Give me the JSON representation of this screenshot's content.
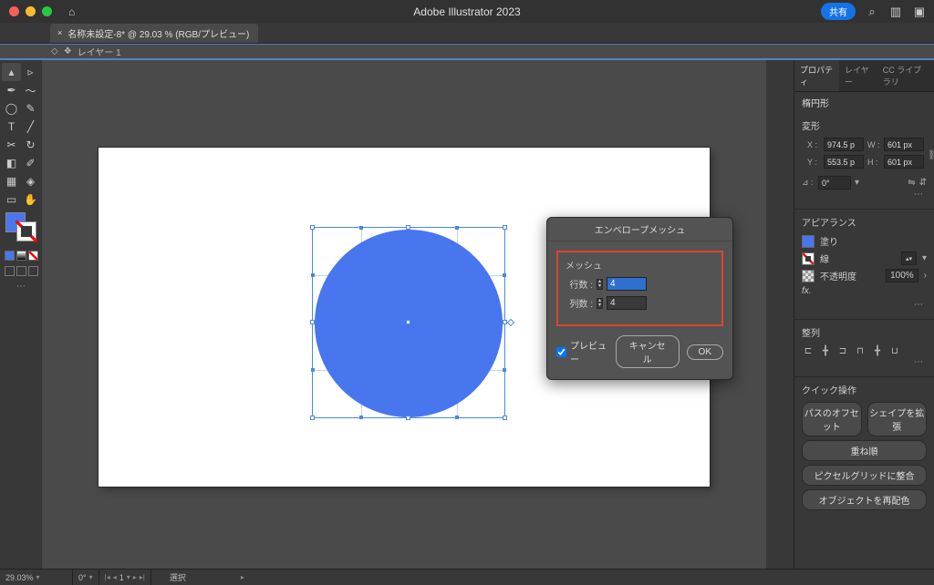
{
  "app": {
    "title": "Adobe Illustrator 2023"
  },
  "titlebar": {
    "share": "共有"
  },
  "document": {
    "tab": "名称未設定-8* @ 29.03 % (RGB/プレビュー)"
  },
  "layerbar": {
    "layer": "レイヤー 1"
  },
  "dialog": {
    "title": "エンベロープメッシュ",
    "group": "メッシュ",
    "rows_label": "行数 :",
    "cols_label": "列数 :",
    "rows_value": "4",
    "cols_value": "4",
    "preview": "プレビュー",
    "cancel": "キャンセル",
    "ok": "OK"
  },
  "props": {
    "tabs": {
      "properties": "プロパティ",
      "layers": "レイヤー",
      "cclib": "CC ライブラリ"
    },
    "object_type": "楕円形",
    "transform": {
      "title": "変形",
      "x_label": "X :",
      "x": "974.5 p",
      "y_label": "Y :",
      "y": "553.5 p",
      "w_label": "W :",
      "w": "601 px",
      "h_label": "H :",
      "h": "601 px",
      "angle_label": "⊿ :",
      "angle": "0°"
    },
    "appearance": {
      "title": "アピアランス",
      "fill": "塗り",
      "stroke": "線",
      "opacity_label": "不透明度",
      "opacity": "100%",
      "fx": "fx."
    },
    "align": {
      "title": "整列"
    },
    "quick": {
      "title": "クイック操作",
      "offset": "パスのオフセット",
      "expand": "シェイプを拡張",
      "arrange": "重ね順",
      "pixelgrid": "ピクセルグリッドに整合",
      "recolor": "オブジェクトを再配色"
    }
  },
  "status": {
    "zoom": "29.03%",
    "rotate": "0°",
    "mode": "選択"
  }
}
